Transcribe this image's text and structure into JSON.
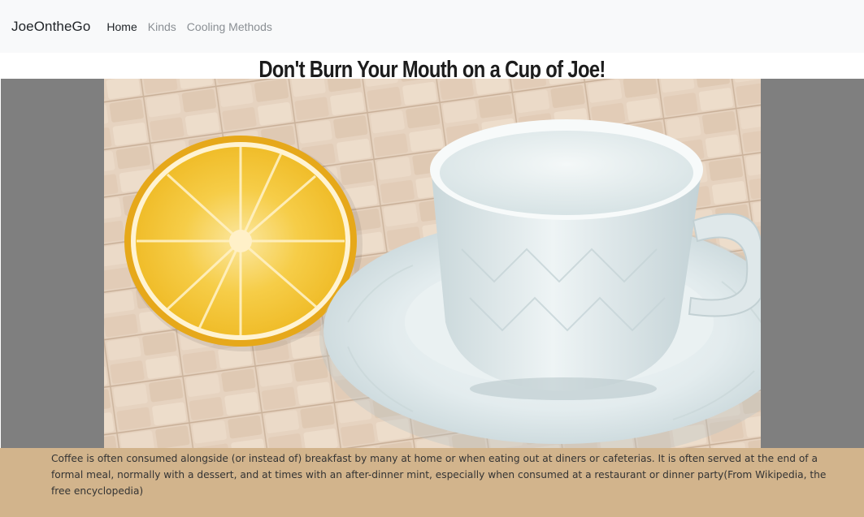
{
  "nav": {
    "brand": "JoeOntheGo",
    "links": [
      {
        "label": "Home",
        "active": true
      },
      {
        "label": "Kinds",
        "active": false
      },
      {
        "label": "Cooling Methods",
        "active": false
      }
    ]
  },
  "header": {
    "title": "Don't Burn Your Mouth on a Cup of Joe!"
  },
  "colors": {
    "navbar_bg": "#f8f9fa",
    "hero_bg": "#7f7f7f",
    "caption_bg": "#d2b48c"
  },
  "caption": {
    "text": "Coffee is often consumed alongside (or instead of) breakfast by many at home or when eating out at diners or cafeterias. It is often served at the end of a formal meal, normally with a dessert, and at times with an after-dinner mint, especially when consumed at a restaurant or dinner party(From Wikipedia, the free encyclopedia)"
  }
}
